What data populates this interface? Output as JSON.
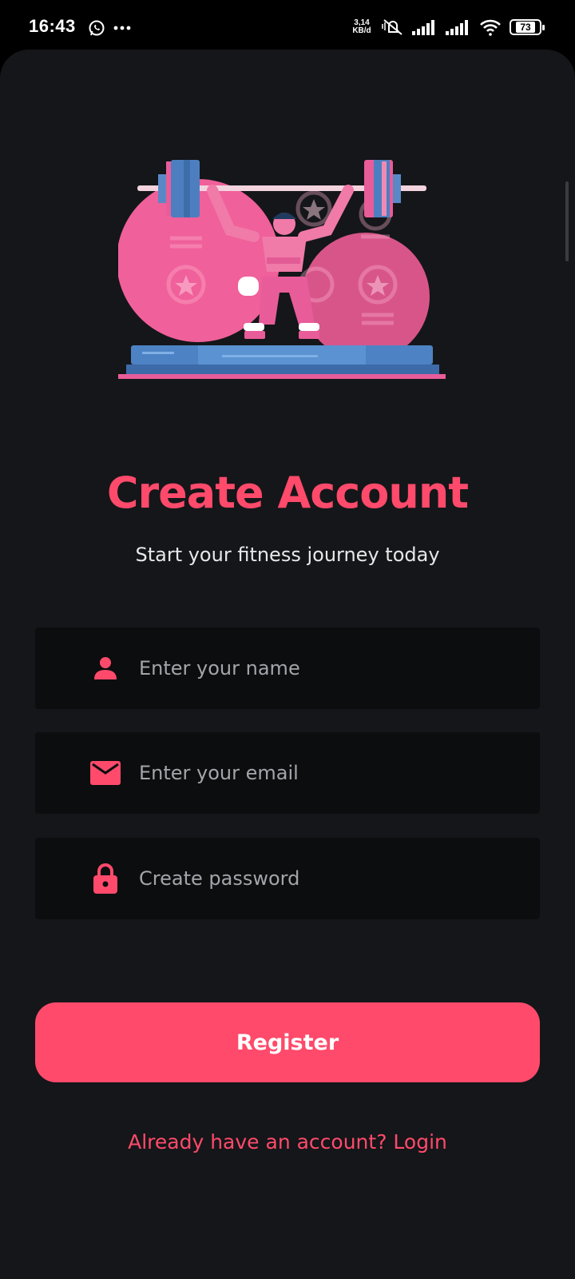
{
  "status_bar": {
    "time": "16:43",
    "net_speed_value": "3,14",
    "net_speed_unit": "KB/d",
    "battery": "73",
    "icons": [
      "whatsapp-icon",
      "more-dots-icon",
      "mute-vibrate-icon",
      "signal-icon",
      "signal-icon",
      "wifi-icon",
      "battery-icon"
    ]
  },
  "hero": {
    "illustration": "weightlifter-illustration"
  },
  "header": {
    "title": "Create Account",
    "subtitle": "Start your fitness journey today"
  },
  "form": {
    "name_placeholder": "Enter your name",
    "email_placeholder": "Enter your email",
    "password_placeholder": "Create password",
    "name_icon": "person-icon",
    "email_icon": "mail-icon",
    "password_icon": "lock-icon"
  },
  "actions": {
    "register_label": "Register",
    "login_link": "Already have an account? Login"
  },
  "colors": {
    "accent": "#ff4a6b",
    "background": "#151619",
    "field_background": "#0c0d0f",
    "text": "#e8e8ea",
    "placeholder": "#a4a5aa"
  }
}
